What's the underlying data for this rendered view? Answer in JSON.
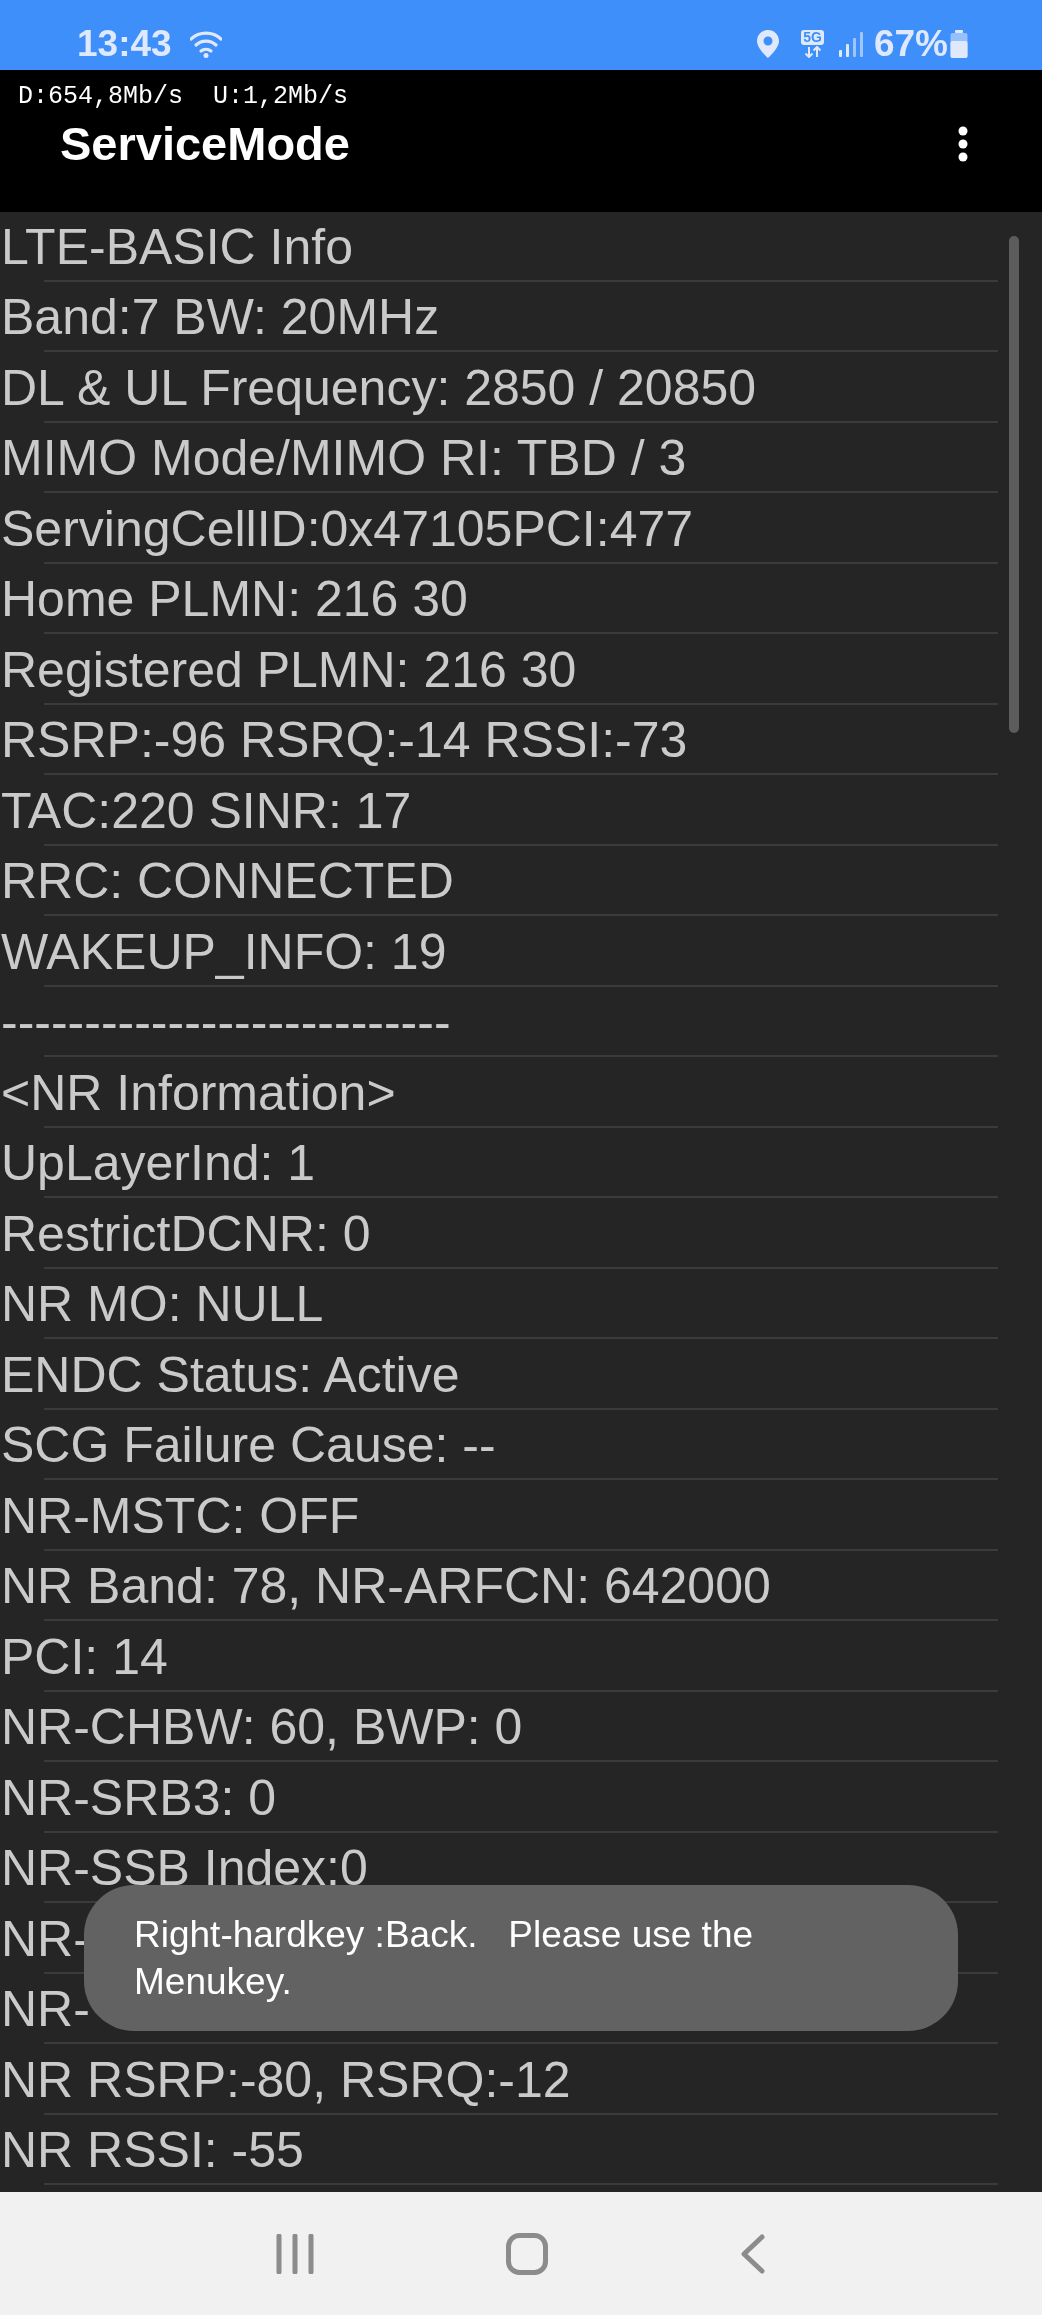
{
  "status_bar": {
    "time": "13:43",
    "network_type": "5G",
    "battery": "67%"
  },
  "app_bar": {
    "speed": "D:654,8Mb/s  U:1,2Mb/s",
    "title": "ServiceMode"
  },
  "rows": [
    "LTE-BASIC Info",
    "Band:7 BW: 20MHz",
    "DL & UL Frequency: 2850 / 20850",
    "MIMO Mode/MIMO RI: TBD / 3",
    "ServingCellID:0x47105PCI:477",
    "Home PLMN: 216 30",
    "Registered PLMN: 216 30",
    "RSRP:-96 RSRQ:-14 RSSI:-73",
    "TAC:220 SINR: 17",
    "RRC: CONNECTED",
    "WAKEUP_INFO: 19",
    "---------------------------",
    "<NR Information>",
    "UpLayerInd: 1",
    "RestrictDCNR: 0",
    "NR MO: NULL",
    "ENDC Status: Active",
    "SCG Failure Cause: --",
    "NR-MSTC: OFF",
    "NR Band: 78, NR-ARFCN: 642000",
    "PCI: 14",
    "NR-CHBW: 60, BWP: 0",
    "NR-SRB3: 0",
    "NR-SSB Index:0",
    "NR-",
    "NR-",
    "NR RSRP:-80, RSRQ:-12",
    "NR RSSI: -55"
  ],
  "toast": {
    "text": "Right-hardkey :Back.   Please use the Menukey."
  }
}
